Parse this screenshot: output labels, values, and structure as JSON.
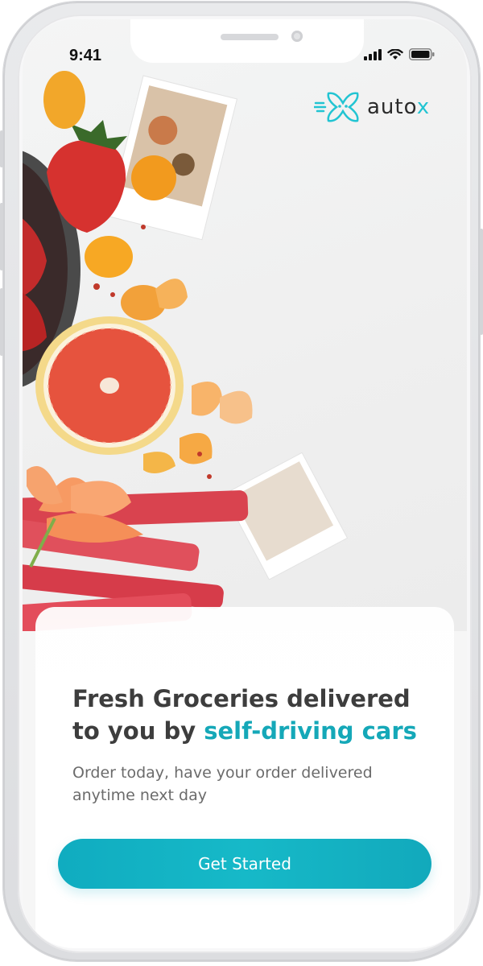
{
  "status_bar": {
    "time": "9:41"
  },
  "logo": {
    "word": "auto",
    "x_letter": "x"
  },
  "hero": {
    "headline_prefix": "Fresh Groceries delivered to you by ",
    "headline_accent": "self-driving cars",
    "subtext": "Order today, have your order delivered anytime next day"
  },
  "cta": {
    "label": "Get Started"
  },
  "colors": {
    "accent": "#15a8b8",
    "button": "#12b0c2",
    "logo_mark": "#22c4d2"
  },
  "icons": [
    "signal-icon",
    "wifi-icon",
    "battery-icon",
    "autox-logo-icon"
  ]
}
